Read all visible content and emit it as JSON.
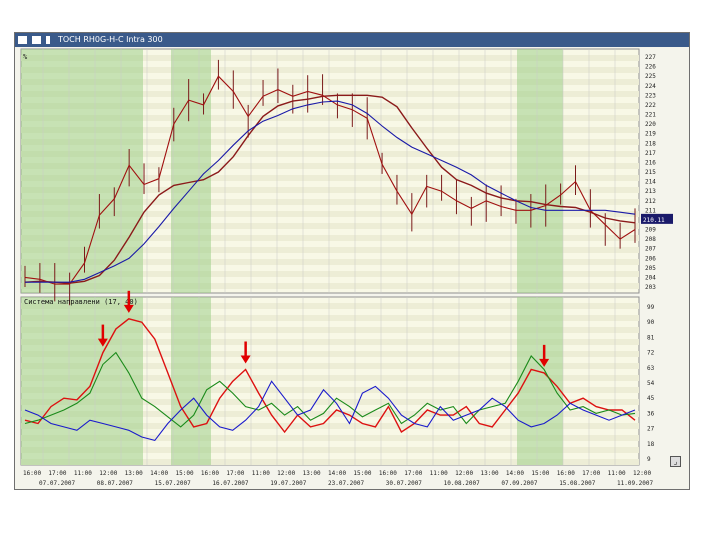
{
  "window": {
    "title": "TOCH RH0G-H-C  Intra 300",
    "icon_names": [
      "chart-window-icon",
      "grid-icon",
      "flag-icon"
    ]
  },
  "chart_data": [
    {
      "type": "line",
      "title": "",
      "corner_label": "%",
      "y_ticks": [
        "227",
        "226",
        "225",
        "224",
        "223",
        "222",
        "221",
        "220",
        "219",
        "218",
        "217",
        "216",
        "215",
        "214",
        "213",
        "212",
        "211",
        "210",
        "209",
        "208",
        "207",
        "206",
        "205",
        "204",
        "203"
      ],
      "last_value_label": "210.11",
      "series": [
        {
          "color": "#8b1a1a",
          "values": [
            203.5,
            203.6,
            203.5,
            203.4,
            203.6,
            204.2,
            205.8,
            208.2,
            210.8,
            212.6,
            213.6,
            213.9,
            214.2,
            215.0,
            216.6,
            218.8,
            220.8,
            221.9,
            222.4,
            222.6,
            222.9,
            223.0,
            223.0,
            223.0,
            222.8,
            221.8,
            219.6,
            217.5,
            215.5,
            214.2,
            213.6,
            212.8,
            212.3,
            212.0,
            211.9,
            211.6,
            211.4,
            211.3,
            210.8,
            210.2,
            209.9,
            209.7
          ]
        },
        {
          "color": "#a01010",
          "values": [
            204.0,
            203.8,
            203.3,
            203.3,
            205.5,
            210.5,
            212.2,
            215.7,
            213.7,
            214.3,
            220.0,
            222.5,
            222.0,
            225.0,
            223.4,
            220.8,
            222.9,
            223.6,
            222.9,
            223.4,
            223.0,
            222.0,
            221.5,
            220.6,
            215.8,
            213.0,
            210.6,
            213.5,
            213.0,
            212.0,
            211.2,
            212.0,
            211.4,
            211.0,
            211.0,
            211.5,
            212.6,
            214.0,
            211.0,
            209.5,
            208.0,
            209.0
          ]
        },
        {
          "color": "#1a1aa8",
          "values": [
            203.5,
            203.5,
            203.5,
            203.5,
            203.8,
            204.5,
            205.2,
            206.0,
            207.5,
            209.3,
            211.2,
            213.0,
            214.8,
            216.2,
            217.8,
            219.3,
            220.3,
            220.9,
            221.6,
            222.0,
            222.3,
            222.4,
            222.0,
            221.1,
            219.8,
            218.6,
            217.6,
            216.9,
            216.2,
            215.5,
            214.7,
            213.6,
            212.8,
            212.0,
            211.3,
            211.0,
            211.0,
            211.0,
            211.0,
            211.0,
            210.8,
            210.6
          ]
        }
      ]
    },
    {
      "type": "line",
      "legend": "Система направлени (17, 40)",
      "y_ticks": [
        "99",
        "90",
        "81",
        "72",
        "63",
        "54",
        "45",
        "36",
        "27",
        "18",
        "9"
      ],
      "series": [
        {
          "color": "#dd1111",
          "values": [
            32,
            30,
            40,
            45,
            44,
            52,
            72,
            86,
            92,
            90,
            80,
            60,
            40,
            28,
            30,
            45,
            55,
            62,
            48,
            35,
            25,
            35,
            28,
            30,
            38,
            35,
            30,
            28,
            40,
            25,
            30,
            38,
            35,
            35,
            40,
            30,
            28,
            38,
            48,
            62,
            60,
            52,
            42,
            45,
            40,
            38,
            38,
            32
          ]
        },
        {
          "color": "#1a8a1a",
          "values": [
            30,
            32,
            35,
            38,
            42,
            48,
            65,
            72,
            60,
            45,
            40,
            34,
            28,
            35,
            50,
            55,
            48,
            40,
            38,
            42,
            35,
            40,
            32,
            36,
            45,
            40,
            34,
            38,
            42,
            30,
            35,
            42,
            38,
            40,
            30,
            38,
            40,
            42,
            55,
            70,
            62,
            48,
            38,
            40,
            36,
            38,
            35,
            36
          ]
        },
        {
          "color": "#1a1acc",
          "values": [
            38,
            35,
            30,
            28,
            26,
            32,
            30,
            28,
            26,
            22,
            20,
            30,
            38,
            45,
            35,
            28,
            26,
            32,
            40,
            55,
            45,
            35,
            38,
            50,
            42,
            30,
            48,
            52,
            45,
            35,
            30,
            28,
            40,
            32,
            35,
            38,
            45,
            40,
            32,
            28,
            30,
            35,
            42,
            38,
            35,
            32,
            35,
            38
          ]
        }
      ],
      "signal_arrows": [
        6,
        8,
        17,
        40
      ]
    }
  ],
  "x_axis": {
    "time_ticks": [
      "16:00",
      "17:00",
      "11:00",
      "12:00",
      "13:00",
      "14:00",
      "15:00",
      "16:00",
      "17:00",
      "11:00",
      "12:00",
      "13:00",
      "14:00",
      "15:00",
      "16:00",
      "17:00",
      "11:00",
      "12:00",
      "13:00",
      "14:00",
      "15:00",
      "16:00",
      "17:00",
      "11:00",
      "12:00"
    ],
    "date_ticks": [
      "07.07.2007",
      "08.07.2007",
      "15.07.2007",
      "16.07.2007",
      "19.07.2007",
      "23.07.2007",
      "30.07.2007",
      "10.08.2007",
      "07.09.2007",
      "15.08.2007",
      "11.09.2007"
    ]
  }
}
